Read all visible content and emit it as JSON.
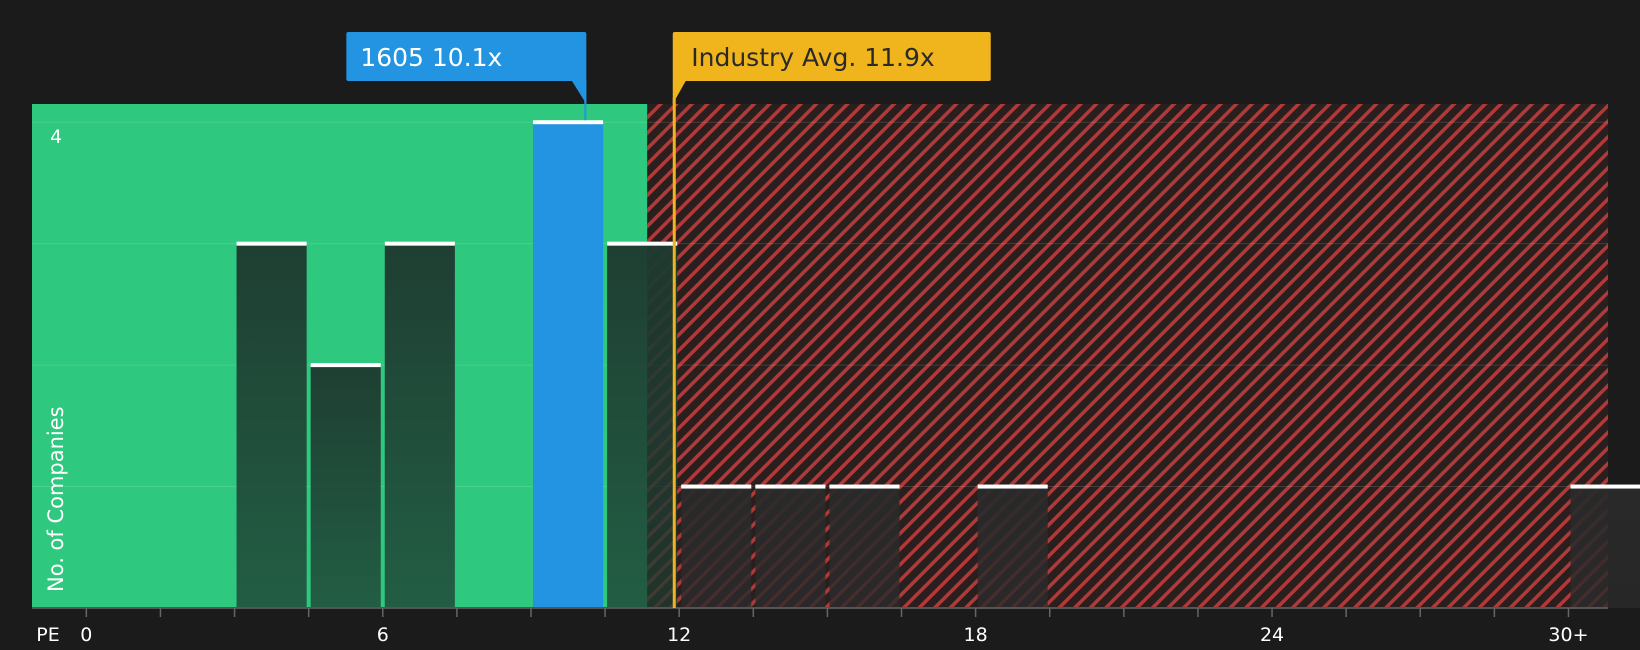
{
  "chart_data": {
    "type": "bar",
    "xlabel": "PE",
    "ylabel": "No. of Companies",
    "x_ticks": [
      {
        "value": 0,
        "label": "0"
      },
      {
        "value": 6,
        "label": "6"
      },
      {
        "value": 12,
        "label": "12"
      },
      {
        "value": 18,
        "label": "18"
      },
      {
        "value": 24,
        "label": "24"
      },
      {
        "value": 30,
        "label": "30+"
      }
    ],
    "y_ticks": [
      {
        "value": 4,
        "label": "4"
      }
    ],
    "xlim": [
      -1.1,
      30.8
    ],
    "ylim": [
      0,
      4.15
    ],
    "bins": [
      {
        "start": 3.0,
        "end": 4.5,
        "count": 3
      },
      {
        "start": 4.5,
        "end": 6.0,
        "count": 2
      },
      {
        "start": 6.0,
        "end": 7.5,
        "count": 3
      },
      {
        "start": 9.0,
        "end": 10.5,
        "count": 4,
        "highlight": true
      },
      {
        "start": 10.5,
        "end": 12.0,
        "count": 3
      },
      {
        "start": 12.0,
        "end": 13.5,
        "count": 1
      },
      {
        "start": 13.5,
        "end": 15.0,
        "count": 1
      },
      {
        "start": 15.0,
        "end": 16.5,
        "count": 1
      },
      {
        "start": 18.0,
        "end": 19.5,
        "count": 1
      },
      {
        "start": 30.0,
        "end": 31.5,
        "count": 1
      }
    ],
    "company": {
      "label": "1605 10.1x",
      "value": 10.1
    },
    "industry_avg": {
      "label": "Industry Avg. 11.9x",
      "value": 11.9
    },
    "grid": true,
    "colors": {
      "background": "#1b1b1b",
      "undervalued_zone": "#2ec87e",
      "overvalued_zone": "#ae3b3a",
      "company_bar": "#2394e1",
      "industry_line": "#f0b41c",
      "bar_dark": "#1f3b32",
      "bar_cap": "#ffffff",
      "text": "#ffffff"
    }
  }
}
